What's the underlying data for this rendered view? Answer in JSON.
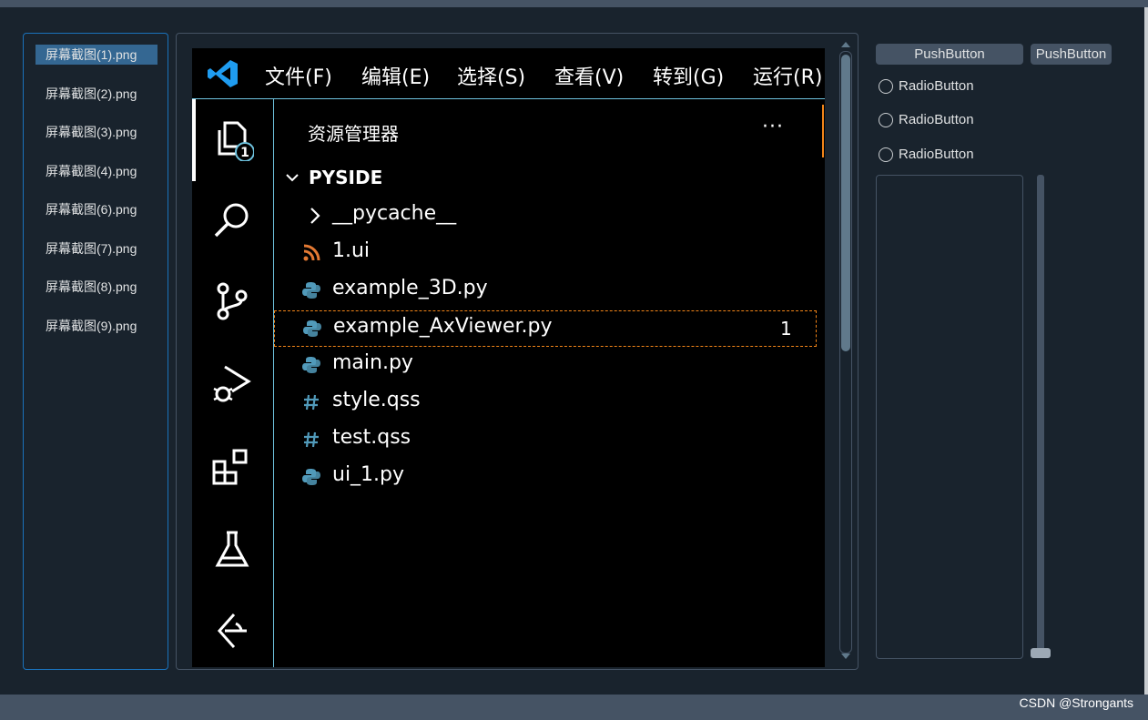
{
  "files": [
    {
      "label": "屏幕截图(1).png",
      "selected": true
    },
    {
      "label": "屏幕截图(2).png",
      "selected": false
    },
    {
      "label": "屏幕截图(3).png",
      "selected": false
    },
    {
      "label": "屏幕截图(4).png",
      "selected": false
    },
    {
      "label": "屏幕截图(6).png",
      "selected": false
    },
    {
      "label": "屏幕截图(7).png",
      "selected": false
    },
    {
      "label": "屏幕截图(8).png",
      "selected": false
    },
    {
      "label": "屏幕截图(9).png",
      "selected": false
    }
  ],
  "preview": {
    "menu": [
      "文件(F)",
      "编辑(E)",
      "选择(S)",
      "查看(V)",
      "转到(G)",
      "运行(R)"
    ],
    "explorer_title": "资源管理器",
    "more": "···",
    "explorer_badge": "1",
    "folder": "PYSIDE",
    "tree": [
      {
        "name": "__pycache__",
        "icon": "chevron-right-icon"
      },
      {
        "name": "1.ui",
        "icon": "rss-icon"
      },
      {
        "name": "example_3D.py",
        "icon": "python-icon"
      },
      {
        "name": "example_AxViewer.py",
        "icon": "python-icon",
        "badge": "1"
      },
      {
        "name": "main.py",
        "icon": "python-icon"
      },
      {
        "name": "style.qss",
        "icon": "hash-icon"
      },
      {
        "name": "test.qss",
        "icon": "hash-icon"
      },
      {
        "name": "ui_1.py",
        "icon": "python-icon"
      }
    ]
  },
  "controls": {
    "push_button_1": "PushButton",
    "push_button_2": "PushButton",
    "radio_1": "RadioButton",
    "radio_2": "RadioButton",
    "radio_3": "RadioButton",
    "slider_value": 0
  },
  "watermark": "CSDN @Strongants",
  "colors": {
    "background": "#19232d",
    "selection": "#346792",
    "accent_border": "#1a72bb",
    "control": "#455364",
    "highlight_outline": "#f38518"
  }
}
